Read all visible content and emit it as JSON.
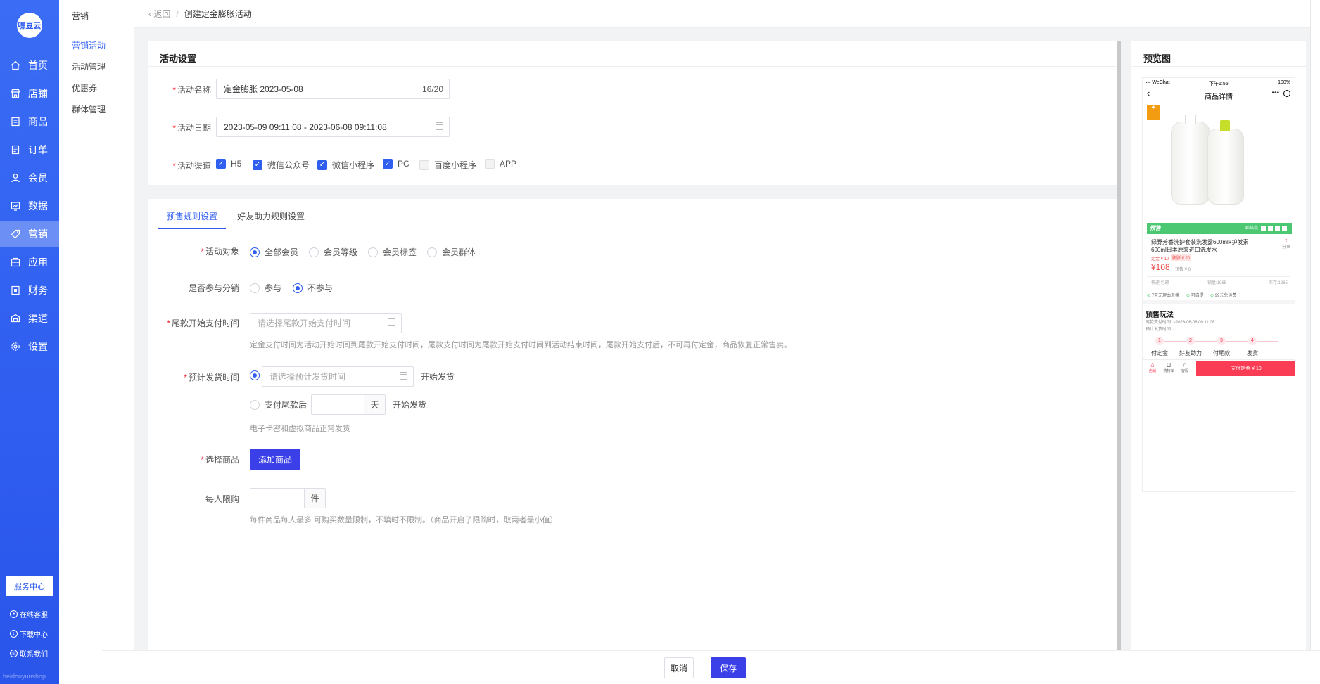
{
  "sidebar": {
    "logo": "嘿豆云",
    "items": [
      {
        "label": "首页",
        "icon": "home-icon"
      },
      {
        "label": "店铺",
        "icon": "store-icon"
      },
      {
        "label": "商品",
        "icon": "product-icon"
      },
      {
        "label": "订单",
        "icon": "order-icon"
      },
      {
        "label": "会员",
        "icon": "user-icon"
      },
      {
        "label": "数据",
        "icon": "chart-icon"
      },
      {
        "label": "营销",
        "icon": "tag-icon"
      },
      {
        "label": "应用",
        "icon": "app-icon"
      },
      {
        "label": "财务",
        "icon": "finance-icon"
      },
      {
        "label": "渠道",
        "icon": "channel-icon"
      },
      {
        "label": "设置",
        "icon": "gear-icon"
      }
    ],
    "service_center": "服务中心",
    "links": [
      "在线客服",
      "下载中心",
      "联系我们"
    ],
    "footer": "heidouyunshop"
  },
  "subnav": {
    "title": "营销",
    "items": [
      "营销活动",
      "活动管理",
      "优惠券",
      "群体管理"
    ]
  },
  "breadcrumb": {
    "back": "返回",
    "current": "创建定金膨胀活动"
  },
  "activity": {
    "title": "活动设置",
    "name_label": "活动名称",
    "name_value": "定金膨胀  2023-05-08",
    "name_count": "16/20",
    "date_label": "活动日期",
    "date_value": "2023-05-09 09:11:08 - 2023-06-08 09:11:08",
    "channel_label": "活动渠道",
    "channels": [
      {
        "label": "H5",
        "checked": true
      },
      {
        "label": "微信公众号",
        "checked": true
      },
      {
        "label": "微信小程序",
        "checked": true
      },
      {
        "label": "PC",
        "checked": true
      },
      {
        "label": "百度小程序",
        "checked": false
      },
      {
        "label": "APP",
        "checked": false
      }
    ]
  },
  "rules": {
    "tabs": [
      "预售规则设置",
      "好友助力规则设置"
    ],
    "target_label": "活动对象",
    "targets": [
      "全部会员",
      "会员等级",
      "会员标签",
      "会员群体"
    ],
    "distribution_label": "是否参与分销",
    "distribution_options": [
      "参与",
      "不参与"
    ],
    "final_pay_label": "尾款开始支付时间",
    "final_pay_placeholder": "请选择尾款开始支付时间",
    "final_pay_hint": "定金支付时间为活动开始时间到尾款开始支付时间，尾款支付时间为尾款开始支付时间到活动结束时间，尾款开始支付后，不可再付定金，商品恢复正常售卖。",
    "ship_label": "预计发货时间",
    "ship_placeholder": "请选择预计发货时间",
    "ship_suffix1": "开始发货",
    "ship_option2": "支付尾款后",
    "ship_unit": "天",
    "ship_suffix2": "开始发货",
    "ship_hint": "电子卡密和虚拟商品正常发货",
    "goods_label": "选择商品",
    "goods_button": "添加商品",
    "limit_label": "每人限购",
    "limit_unit": "件",
    "limit_hint": "每件商品每人最多 可购买数量限制，不填时不限制。（商品开启了限购时，取两者最小值）"
  },
  "footer": {
    "cancel": "取消",
    "save": "保存"
  },
  "preview": {
    "title": "预览图",
    "status_left": "WeChat",
    "status_time": "下午1:55",
    "status_battery": "100%",
    "page_title": "商品详情",
    "badge": "预售",
    "countdown_label": "距结束",
    "product_name": "绿野芳香洗护套装洗发露600ml+护发素600ml日本原装进口洗发水",
    "deposit": "定金 ¥ 10",
    "deposit_tag": "膨胀 ¥ 20",
    "price": "¥108",
    "original": "预售 ¥ 0",
    "meta": [
      "快递 包邮",
      "销量:1965",
      "库存:1965"
    ],
    "guarantees": [
      "7天无理由退换",
      "可自提",
      "99元免运费"
    ],
    "share": "分享",
    "presale_title": "预售玩法",
    "pay_time": "尾款支付时间: ~2023-06-08 09:11:08",
    "ship_time": "预计发货时间: -",
    "steps": [
      {
        "num": "1",
        "label": "付定金"
      },
      {
        "num": "2",
        "label": "好友助力"
      },
      {
        "num": "3",
        "label": "付尾款"
      },
      {
        "num": "4",
        "label": "发货"
      }
    ],
    "tabbar": [
      "店铺",
      "购物车",
      "客服"
    ],
    "pay_button": "支付定金 ¥ 10",
    "colors": {
      "accent": "#2f5ef0",
      "presale_green": "#4cc873",
      "pay_red": "#fa3c55"
    }
  }
}
